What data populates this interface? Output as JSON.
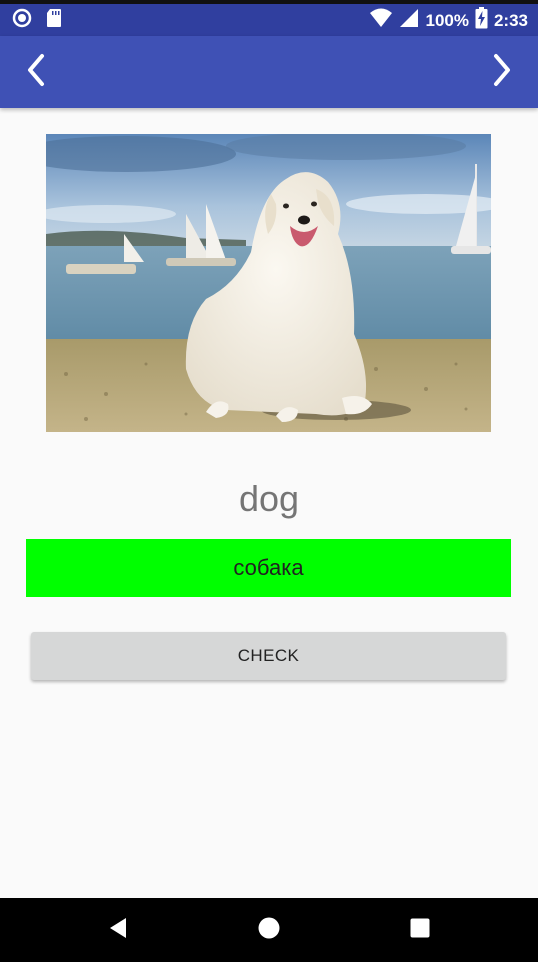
{
  "status_bar": {
    "battery_percent": "100%",
    "time": "2:33",
    "icons": [
      "record-icon",
      "sd-card-icon",
      "wifi-icon",
      "signal-icon",
      "battery-charging-icon"
    ]
  },
  "app_bar": {
    "color": "#3f51b5",
    "left_icon": "chevron-left-icon",
    "right_icon": "chevron-right-icon"
  },
  "card": {
    "image": "dog-photo",
    "word": "dog",
    "answer_value": "собака",
    "answer_color": "#00ff00",
    "check_label": "CHECK"
  },
  "system_nav": {
    "icons": [
      "back-icon",
      "home-icon",
      "recents-icon"
    ]
  }
}
